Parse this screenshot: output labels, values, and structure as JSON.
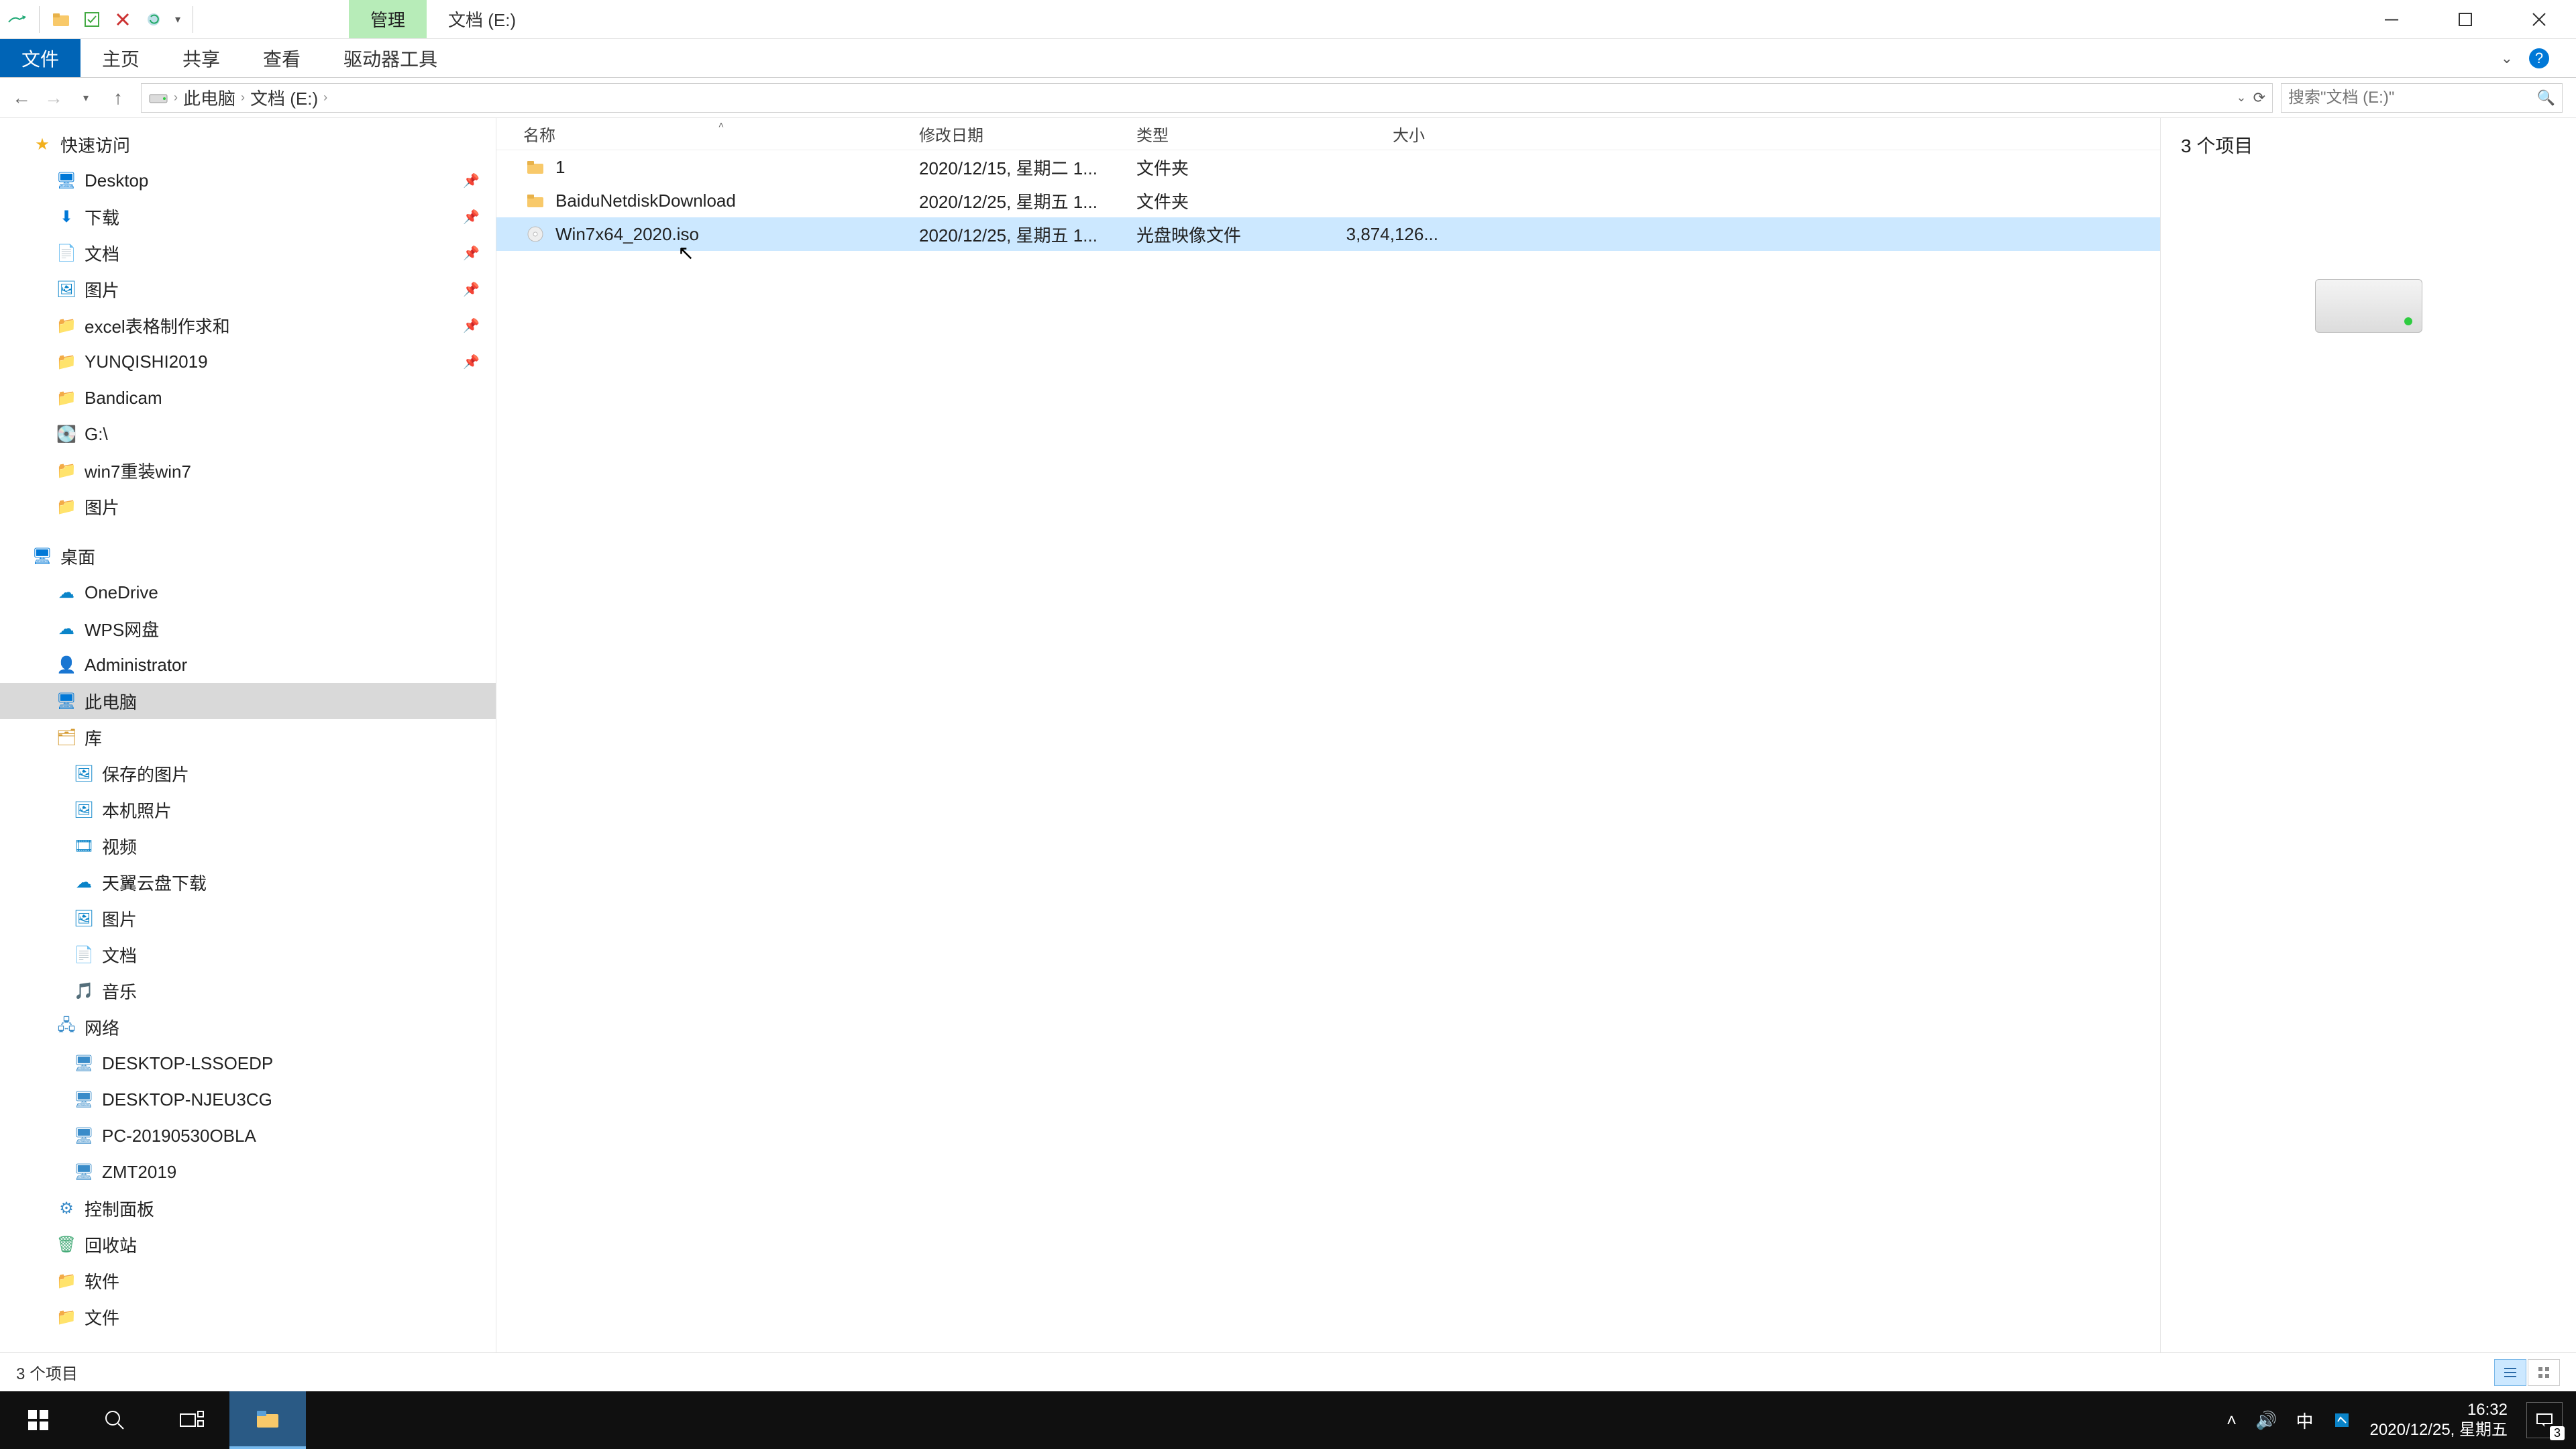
{
  "title_context_tab": "管理",
  "title_location": "文档 (E:)",
  "ribbon": {
    "file": "文件",
    "home": "主页",
    "share": "共享",
    "view": "查看",
    "drive_tools": "驱动器工具"
  },
  "breadcrumbs": [
    "此电脑",
    "文档 (E:)"
  ],
  "search_placeholder": "搜索\"文档 (E:)\"",
  "columns": {
    "name": "名称",
    "date": "修改日期",
    "type": "类型",
    "size": "大小"
  },
  "rows": [
    {
      "icon": "folder",
      "name": "1",
      "date": "2020/12/15, 星期二 1...",
      "type": "文件夹",
      "size": ""
    },
    {
      "icon": "folder",
      "name": "BaiduNetdiskDownload",
      "date": "2020/12/25, 星期五 1...",
      "type": "文件夹",
      "size": ""
    },
    {
      "icon": "iso",
      "name": "Win7x64_2020.iso",
      "date": "2020/12/25, 星期五 1...",
      "type": "光盘映像文件",
      "size": "3,874,126..."
    }
  ],
  "tree": {
    "quick_access": "快速访问",
    "quick_items": [
      {
        "label": "Desktop",
        "icon": "desktop",
        "pin": true
      },
      {
        "label": "下载",
        "icon": "downloads",
        "pin": true
      },
      {
        "label": "文档",
        "icon": "documents",
        "pin": true
      },
      {
        "label": "图片",
        "icon": "pictures",
        "pin": true
      },
      {
        "label": "excel表格制作求和",
        "icon": "folder",
        "pin": true
      },
      {
        "label": "YUNQISHI2019",
        "icon": "folder",
        "pin": true
      },
      {
        "label": "Bandicam",
        "icon": "folder",
        "pin": false
      },
      {
        "label": "G:\\",
        "icon": "drive",
        "pin": false
      },
      {
        "label": "win7重装win7",
        "icon": "folder",
        "pin": false
      },
      {
        "label": "图片",
        "icon": "folder",
        "pin": false
      }
    ],
    "desktop": "桌面",
    "desktop_items": [
      {
        "label": "OneDrive",
        "icon": "cloud"
      },
      {
        "label": "WPS网盘",
        "icon": "cloud"
      },
      {
        "label": "Administrator",
        "icon": "user"
      },
      {
        "label": "此电脑",
        "icon": "pc",
        "selected": true
      },
      {
        "label": "库",
        "icon": "library"
      }
    ],
    "library_items": [
      {
        "label": "保存的图片",
        "icon": "pictures"
      },
      {
        "label": "本机照片",
        "icon": "pictures"
      },
      {
        "label": "视频",
        "icon": "video"
      },
      {
        "label": "天翼云盘下载",
        "icon": "cloud"
      },
      {
        "label": "图片",
        "icon": "pictures"
      },
      {
        "label": "文档",
        "icon": "documents"
      },
      {
        "label": "音乐",
        "icon": "music"
      }
    ],
    "network": "网络",
    "network_items": [
      {
        "label": "DESKTOP-LSSOEDP",
        "icon": "netpc"
      },
      {
        "label": "DESKTOP-NJEU3CG",
        "icon": "netpc"
      },
      {
        "label": "PC-20190530OBLA",
        "icon": "netpc"
      },
      {
        "label": "ZMT2019",
        "icon": "netpc"
      }
    ],
    "control_panel": "控制面板",
    "recycle_bin": "回收站",
    "software": "软件",
    "documents": "文件"
  },
  "preview_count": "3 个项目",
  "status_text": "3 个项目",
  "clock": {
    "time": "16:32",
    "date": "2020/12/25, 星期五"
  },
  "ime": "中",
  "notification_count": "3"
}
